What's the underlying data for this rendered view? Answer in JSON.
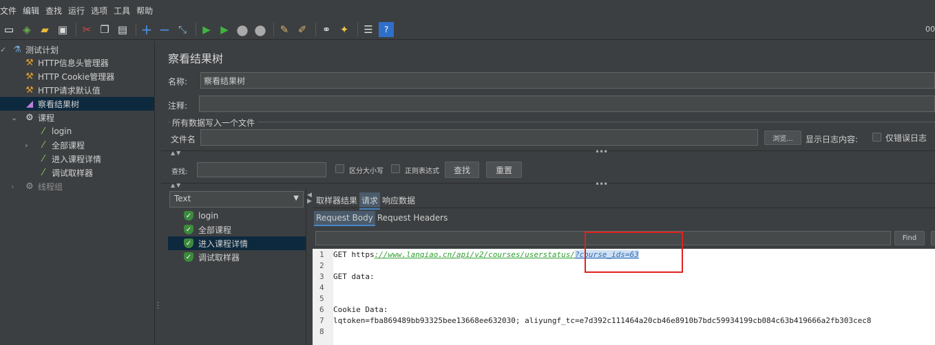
{
  "menu": [
    "文件",
    "编辑",
    "查找",
    "运行",
    "选项",
    "工具",
    "帮助"
  ],
  "toolbar": {
    "icons": [
      "new-icon",
      "templates-icon",
      "open-icon",
      "save-icon",
      "cut-icon",
      "copy-icon",
      "paste-icon",
      "expand-icon",
      "collapse-icon",
      "toggle-icon",
      "start-icon",
      "start-no-pause-icon",
      "stop-icon",
      "shutdown-icon",
      "clear-icon",
      "clear-all-icon",
      "search-icon",
      "reset-search-icon",
      "function-helper-icon",
      "help-icon"
    ],
    "timer": "00"
  },
  "tree": {
    "items": [
      {
        "label": "测试计划",
        "icon": "flask-icon"
      },
      {
        "label": "HTTP信息头管理器",
        "icon": "wrench-icon"
      },
      {
        "label": "HTTP Cookie管理器",
        "icon": "wrench-icon"
      },
      {
        "label": "HTTP请求默认值",
        "icon": "wrench-icon"
      },
      {
        "label": "察看结果树",
        "icon": "chart-icon"
      },
      {
        "label": "课程",
        "icon": "gear-icon"
      },
      {
        "label": "login",
        "icon": "pipette-icon"
      },
      {
        "label": "全部课程",
        "icon": "pipette-icon"
      },
      {
        "label": "进入课程详情",
        "icon": "pipette-icon"
      },
      {
        "label": "调试取样器",
        "icon": "pipette-icon"
      },
      {
        "label": "线程组",
        "icon": "gear-icon"
      }
    ]
  },
  "panel": {
    "title": "察看结果树",
    "name_label": "名称:",
    "name_value": "察看结果树",
    "comment_label": "注释:",
    "comment_value": "",
    "file_group": "所有数据写入一个文件",
    "filename_label": "文件名",
    "filename_value": "",
    "browse": "浏览...",
    "log_label": "显示日志内容:",
    "errors_only": "仅错误日志"
  },
  "search": {
    "label": "查找:",
    "value": "",
    "case_sensitive": "区分大小写",
    "regex": "正则表达式",
    "find_button": "查找",
    "reset_button": "重置"
  },
  "results": {
    "renderer": "Text",
    "samples": [
      "login",
      "全部课程",
      "进入课程详情",
      "调试取样器"
    ],
    "selected": "进入课程详情",
    "tabs": [
      "取样器结果",
      "请求",
      "响应数据"
    ],
    "active_tab": "请求",
    "subtabs": [
      "Request Body",
      "Request Headers"
    ],
    "active_subtab": "Request Body",
    "find_value": "",
    "find_button": "Find"
  },
  "editor": {
    "line_numbers": [
      "1",
      "2",
      "3",
      "4",
      "5",
      "6",
      "7",
      "8"
    ],
    "line1_method": "GET https",
    "line1_url": "://www.lanqiao.cn/api/v2/courses/userstatus/",
    "line1_param": "?course_ids=63",
    "line3": "GET data:",
    "line6": "Cookie Data:",
    "line7": "lqtoken=fba869489bb93325bee13668ee632030; aliyungf_tc=e7d392c111464a20cb46e8910b7bdc59934199cb084c63b419666a2fb303cec8"
  },
  "colors": {
    "background": "#3c3f41",
    "selection": "#0d293e",
    "highlight_box": "#e0201c",
    "url_green": "#2e9e2e"
  }
}
